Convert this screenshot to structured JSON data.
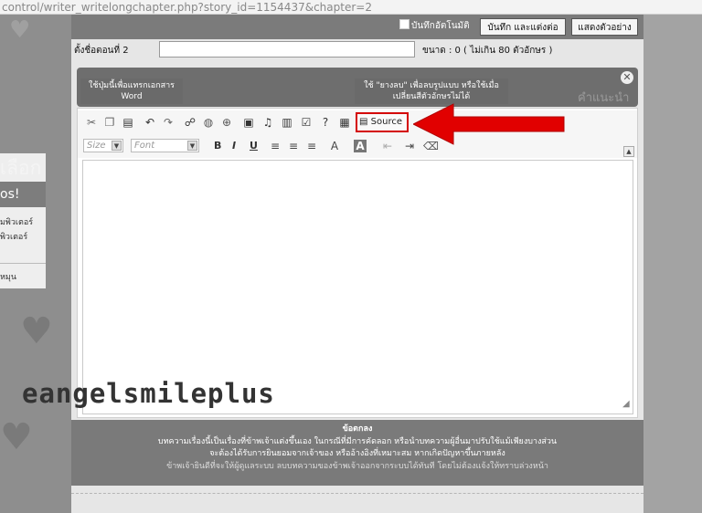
{
  "browser": {
    "url": "control/writer_writelongchapter.php?story_id=1154437&chapter=2"
  },
  "header": {
    "autosave_label": "บันทึกอัตโนมัติ",
    "save_button": "บันทึก และแต่งต่อ",
    "preview_button": "แสดงตัวอย่าง"
  },
  "form": {
    "title_label": "ตั้งชื่อตอนที่ 2",
    "title_value": "",
    "size_note": "ขนาด : 0 ( ไม่เกิน 80 ตัวอักษร )"
  },
  "tips": {
    "tip1": "ใช้ปุ่มนี้เพื่อแทรกเอกสาร Word",
    "tip2": "ใช้ \"ยางลบ\" เพื่อลบรูปแบบ หรือใช้เมื่อ เปลี่ยนสีตัวอักษรไม่ได้",
    "label": "คำแนะนำ",
    "close": "✕"
  },
  "editor": {
    "source_label": "Source",
    "size_combo": "Size",
    "font_combo": "Font",
    "format_buttons": [
      "B",
      "I",
      "U"
    ],
    "content": ""
  },
  "left_panel": {
    "heading": "เลือก",
    "bar": "os!",
    "line1": "มพิวเตอร์",
    "line2": "พิวเตอร์",
    "line3": "หมุน"
  },
  "watermark": "eangelsmileplus",
  "agreement": {
    "title": "ข้อตกลง",
    "line1": "บทความเรื่องนี้เป็นเรื่องที่ข้าพเจ้าแต่งขึ้นเอง ในกรณีที่มีการคัดลอก หรือนำบทความผู้อื่นมาปรับใช้แม้เพียงบางส่วน",
    "line2": "จะต้องได้รับการยินยอมจากเจ้าของ หรืออ้างอิงที่เหมาะสม หากเกิดปัญหาขึ้นภายหลัง",
    "line3": "ข้าพเจ้ายินดีที่จะให้ผู้ดูแลระบบ ลบบทความของข้าพเจ้าออกจากระบบได้ทันที โดยไม่ต้องแจ้งให้ทราบล่วงหน้า"
  },
  "colors": {
    "highlight": "#d40000",
    "arrow": "#e10000",
    "panel": "#7a7a7a"
  }
}
